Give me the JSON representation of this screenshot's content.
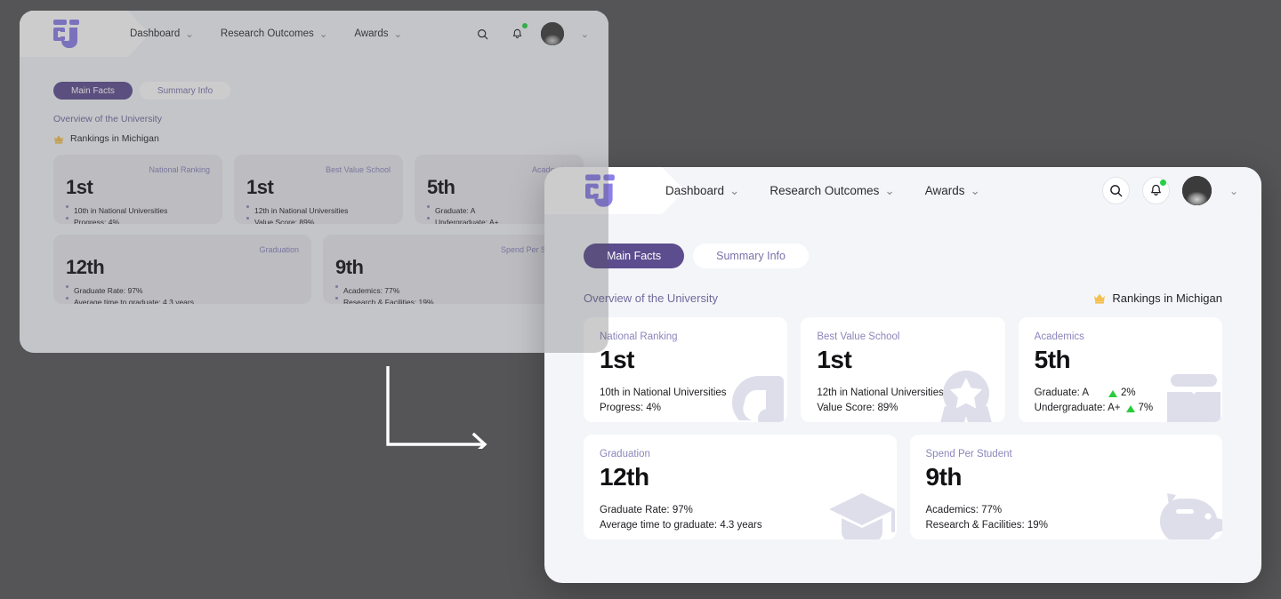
{
  "background": {
    "color": "#555557"
  },
  "arrow": {
    "name": "flow-arrow",
    "color": "#ffffff"
  },
  "brand": {
    "logo_name": "cj-monogram-logo",
    "accent": "#8b7fe8",
    "tab_active_color": "#5c4d8e"
  },
  "nav": {
    "items": [
      {
        "label": "Dashboard",
        "caret": "⌄"
      },
      {
        "label": "Research Outcomes",
        "caret": "⌄"
      },
      {
        "label": "Awards",
        "caret": "⌄"
      }
    ]
  },
  "topbar_right": {
    "search_icon": "search-icon",
    "bell_icon": "bell-icon",
    "notification_dot_color": "#27d045",
    "avatar_name": "user-avatar",
    "avatar_caret": "⌄"
  },
  "tabs": [
    {
      "label": "Main Facts",
      "active": true
    },
    {
      "label": "Summary Info",
      "active": false
    }
  ],
  "section": {
    "title": "Overview of the University",
    "ranking_chip": "Rankings in Michigan",
    "crown_icon": "crown-icon",
    "crown_color": "#f5c04e"
  },
  "cards_row1": [
    {
      "label": "National Ranking",
      "value": "1st",
      "lines": [
        {
          "text": "10th in National Universities"
        },
        {
          "text": "Progress: 4%"
        }
      ],
      "watermark": "medal-number-one-icon"
    },
    {
      "label": "Best Value School",
      "value": "1st",
      "lines": [
        {
          "text": "12th in National Universities"
        },
        {
          "text": "Value Score: 89%"
        }
      ],
      "watermark": "star-award-badge-icon"
    },
    {
      "label": "Academics",
      "value": "5th",
      "lines": [
        {
          "text": "Graduate: A",
          "delta": "2%",
          "delta_dir": "up"
        },
        {
          "text": "Undergraduate: A+",
          "delta": "7%",
          "delta_dir": "up"
        }
      ],
      "watermark": "open-book-icon"
    }
  ],
  "cards_row2": [
    {
      "label": "Graduation",
      "value": "12th",
      "lines": [
        {
          "text": "Graduate Rate: 97%"
        },
        {
          "text": "Average time to graduate: 4.3 years"
        }
      ],
      "watermark": "graduation-cap-icon"
    },
    {
      "label": "Spend Per Student",
      "value": "9th",
      "lines": [
        {
          "text": "Academics: 77%"
        },
        {
          "text": "Research & Facilities: 19%"
        }
      ],
      "watermark": "piggy-bank-icon"
    }
  ]
}
